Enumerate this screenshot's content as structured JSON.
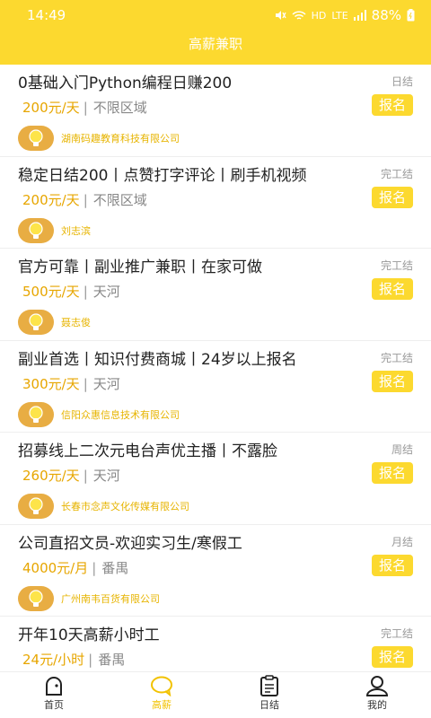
{
  "status_bar": {
    "time": "14:49",
    "network": "HD",
    "lte": "LTE",
    "battery": "88%"
  },
  "nav": {
    "title": "高薪兼职"
  },
  "jobs": [
    {
      "title": "0基础入门Python编程日赚200",
      "settle": "日结",
      "salary": "200元/天",
      "area": "不限区域",
      "apply": "报名",
      "company": "湖南码趣教育科技有限公司"
    },
    {
      "title": "稳定日结200丨点赞打字评论丨刷手机视频",
      "settle": "完工结",
      "salary": "200元/天",
      "area": "不限区域",
      "apply": "报名",
      "company": "刘志滨"
    },
    {
      "title": "官方可靠丨副业推广兼职丨在家可做",
      "settle": "完工结",
      "salary": "500元/天",
      "area": "天河",
      "apply": "报名",
      "company": "聂志俊"
    },
    {
      "title": "副业首选丨知识付费商城丨24岁以上报名",
      "settle": "完工结",
      "salary": "300元/天",
      "area": "天河",
      "apply": "报名",
      "company": "信阳众惠信息技术有限公司"
    },
    {
      "title": "招募线上二次元电台声优主播丨不露脸",
      "settle": "周结",
      "salary": "260元/天",
      "area": "天河",
      "apply": "报名",
      "company": "长春市念声文化传媒有限公司"
    },
    {
      "title": "公司直招文员-欢迎实习生/寒假工",
      "settle": "月结",
      "salary": "4000元/月",
      "area": "番禺",
      "apply": "报名",
      "company": "广州南韦百货有限公司"
    },
    {
      "title": "开年10天高薪小时工",
      "settle": "完工结",
      "salary": "24元/小时",
      "area": "番禺",
      "apply": "报名",
      "company": ""
    }
  ],
  "tabs": [
    {
      "label": "首页",
      "icon": "home-icon"
    },
    {
      "label": "高薪",
      "icon": "chat-bubble-icon"
    },
    {
      "label": "日结",
      "icon": "clipboard-icon"
    },
    {
      "label": "我的",
      "icon": "user-icon"
    }
  ],
  "colors": {
    "accent": "#fcd92f",
    "salary": "#e7a600",
    "bulb_bg": "#e8ad43"
  }
}
